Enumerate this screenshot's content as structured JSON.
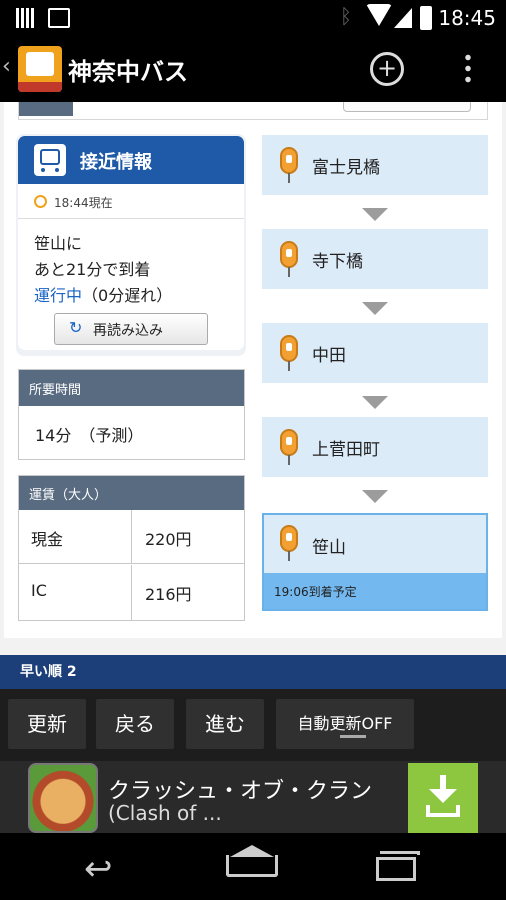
{
  "status_bar": {
    "time": "18:45"
  },
  "app": {
    "title": "神奈中バス"
  },
  "approach": {
    "header": "接近情報",
    "timestamp": "18:44現在",
    "line1": "笹山に",
    "line2": "あと21分で到着",
    "running": "運行中",
    "delay": "（0分遅れ）",
    "reload": "再読み込み"
  },
  "duration": {
    "header": "所要時間",
    "value": "14分　（予測）"
  },
  "fare": {
    "header": "運賃（大人）",
    "rows": [
      {
        "type": "現金",
        "price": "220円"
      },
      {
        "type": "IC",
        "price": "216円"
      }
    ]
  },
  "stops": [
    {
      "name": "富士見橋"
    },
    {
      "name": "寺下橋"
    },
    {
      "name": "中田"
    },
    {
      "name": "上菅田町"
    },
    {
      "name": "笹山",
      "arrival": "19:06到着予定"
    }
  ],
  "rank_bar": {
    "label": "早い順 2"
  },
  "toolbar": {
    "refresh": "更新",
    "back": "戻る",
    "forward": "進む",
    "auto": "自動更新OFF"
  },
  "ad": {
    "title": "クラッシュ・オブ・クラン",
    "subtitle": "(Clash of ..."
  }
}
